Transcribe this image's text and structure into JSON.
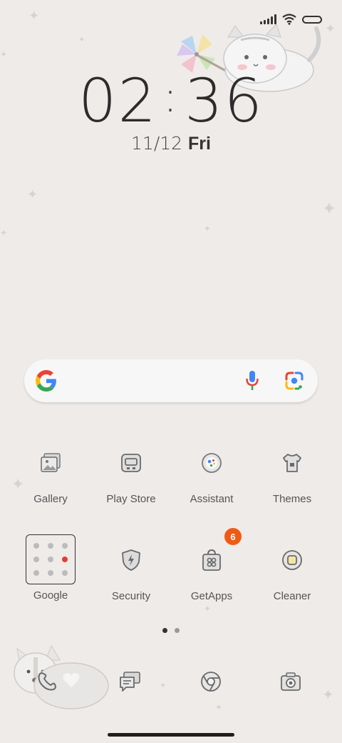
{
  "status": {
    "signal_bars": 5,
    "wifi": "wifi-icon",
    "battery": "battery-icon"
  },
  "clock": {
    "hours": "02",
    "minutes": "36"
  },
  "date": {
    "date": "11/12",
    "day": "Fri"
  },
  "search": {
    "logo": "google-g-icon",
    "mic": "mic-icon",
    "lens": "lens-icon"
  },
  "apps_row1": [
    {
      "label": "Gallery",
      "icon": "gallery-icon"
    },
    {
      "label": "Play Store",
      "icon": "play-store-icon"
    },
    {
      "label": "Assistant",
      "icon": "assistant-icon"
    },
    {
      "label": "Themes",
      "icon": "themes-icon"
    }
  ],
  "apps_row2": [
    {
      "label": "Google",
      "icon": "folder-icon"
    },
    {
      "label": "Security",
      "icon": "security-icon"
    },
    {
      "label": "GetApps",
      "icon": "getapps-icon",
      "badge": "6"
    },
    {
      "label": "Cleaner",
      "icon": "cleaner-icon"
    }
  ],
  "page_indicator": {
    "pages": 2,
    "current": 1
  },
  "dock": [
    {
      "icon": "phone-icon"
    },
    {
      "icon": "messages-icon"
    },
    {
      "icon": "browser-icon"
    },
    {
      "icon": "camera-icon"
    }
  ],
  "colors": {
    "background": "#efebe9",
    "badge": "#f05a14",
    "text": "#333333"
  }
}
